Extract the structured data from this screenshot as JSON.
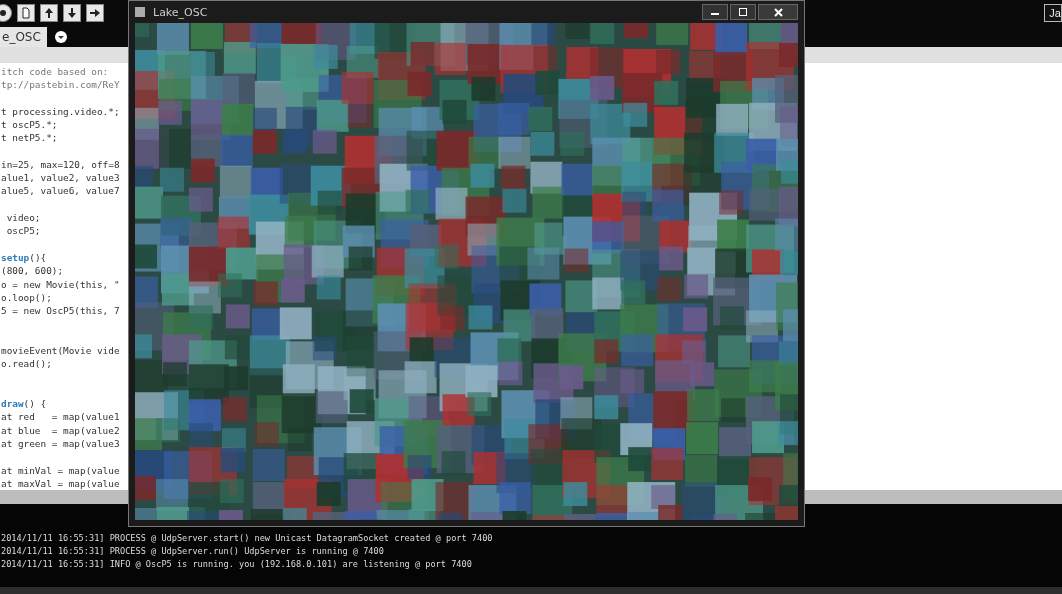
{
  "toolbar": {
    "buttons": [
      {
        "kind": "run"
      },
      {
        "kind": "new"
      },
      {
        "kind": "open"
      },
      {
        "kind": "save"
      },
      {
        "kind": "export"
      }
    ],
    "mode": "Ja"
  },
  "tabs": [
    {
      "label": "e_OSC",
      "selected": true
    }
  ],
  "editor": {
    "lines": [
      {
        "kind": "comment",
        "text": "itch code based on:"
      },
      {
        "kind": "comment",
        "text": "tp://pastebin.com/ReY"
      },
      {
        "kind": "blank"
      },
      {
        "kind": "code",
        "text": "t processing.video.*;"
      },
      {
        "kind": "code",
        "text": "t oscP5.*;"
      },
      {
        "kind": "code",
        "text": "t netP5.*;"
      },
      {
        "kind": "blank"
      },
      {
        "kind": "code",
        "text": "in=25, max=120, off=8"
      },
      {
        "kind": "code",
        "text": "alue1, value2, value3"
      },
      {
        "kind": "code",
        "text": "alue5, value6, value7"
      },
      {
        "kind": "blank"
      },
      {
        "kind": "code",
        "text": " video;"
      },
      {
        "kind": "code",
        "text": " oscP5;"
      },
      {
        "kind": "blank"
      },
      {
        "kind": "code",
        "text": "**setup**(){"
      },
      {
        "kind": "code",
        "text": "(800, 600);"
      },
      {
        "kind": "code",
        "text": "o = new Movie(this, \""
      },
      {
        "kind": "code",
        "text": "o.loop();"
      },
      {
        "kind": "code",
        "text": "5 = new OscP5(this, 7"
      },
      {
        "kind": "blank"
      },
      {
        "kind": "blank"
      },
      {
        "kind": "code",
        "text": "movieEvent(Movie vide"
      },
      {
        "kind": "code",
        "text": "o.read();"
      },
      {
        "kind": "blank"
      },
      {
        "kind": "blank"
      },
      {
        "kind": "code",
        "text": "**draw**() {"
      },
      {
        "kind": "code",
        "text": "at red   = map(value1"
      },
      {
        "kind": "code",
        "text": "at blue  = map(value2"
      },
      {
        "kind": "code",
        "text": "at green = map(value3"
      },
      {
        "kind": "blank"
      },
      {
        "kind": "code",
        "text": "at minVal = map(value"
      },
      {
        "kind": "code",
        "text": "at maxVal = map(value"
      }
    ]
  },
  "console": {
    "lines": [
      "2014/11/11 16:55:31] PROCESS @ UdpServer.start() new Unicast DatagramSocket created @ port 7400",
      "2014/11/11 16:55:31] PROCESS @ UdpServer.run() UdpServer is running @ 7400",
      "2014/11/11 16:55:31] INFO @ OscP5 is running. you (192.168.0.101) are listening @ port 7400"
    ]
  },
  "sketch_window": {
    "title": "Lake_OSC"
  }
}
